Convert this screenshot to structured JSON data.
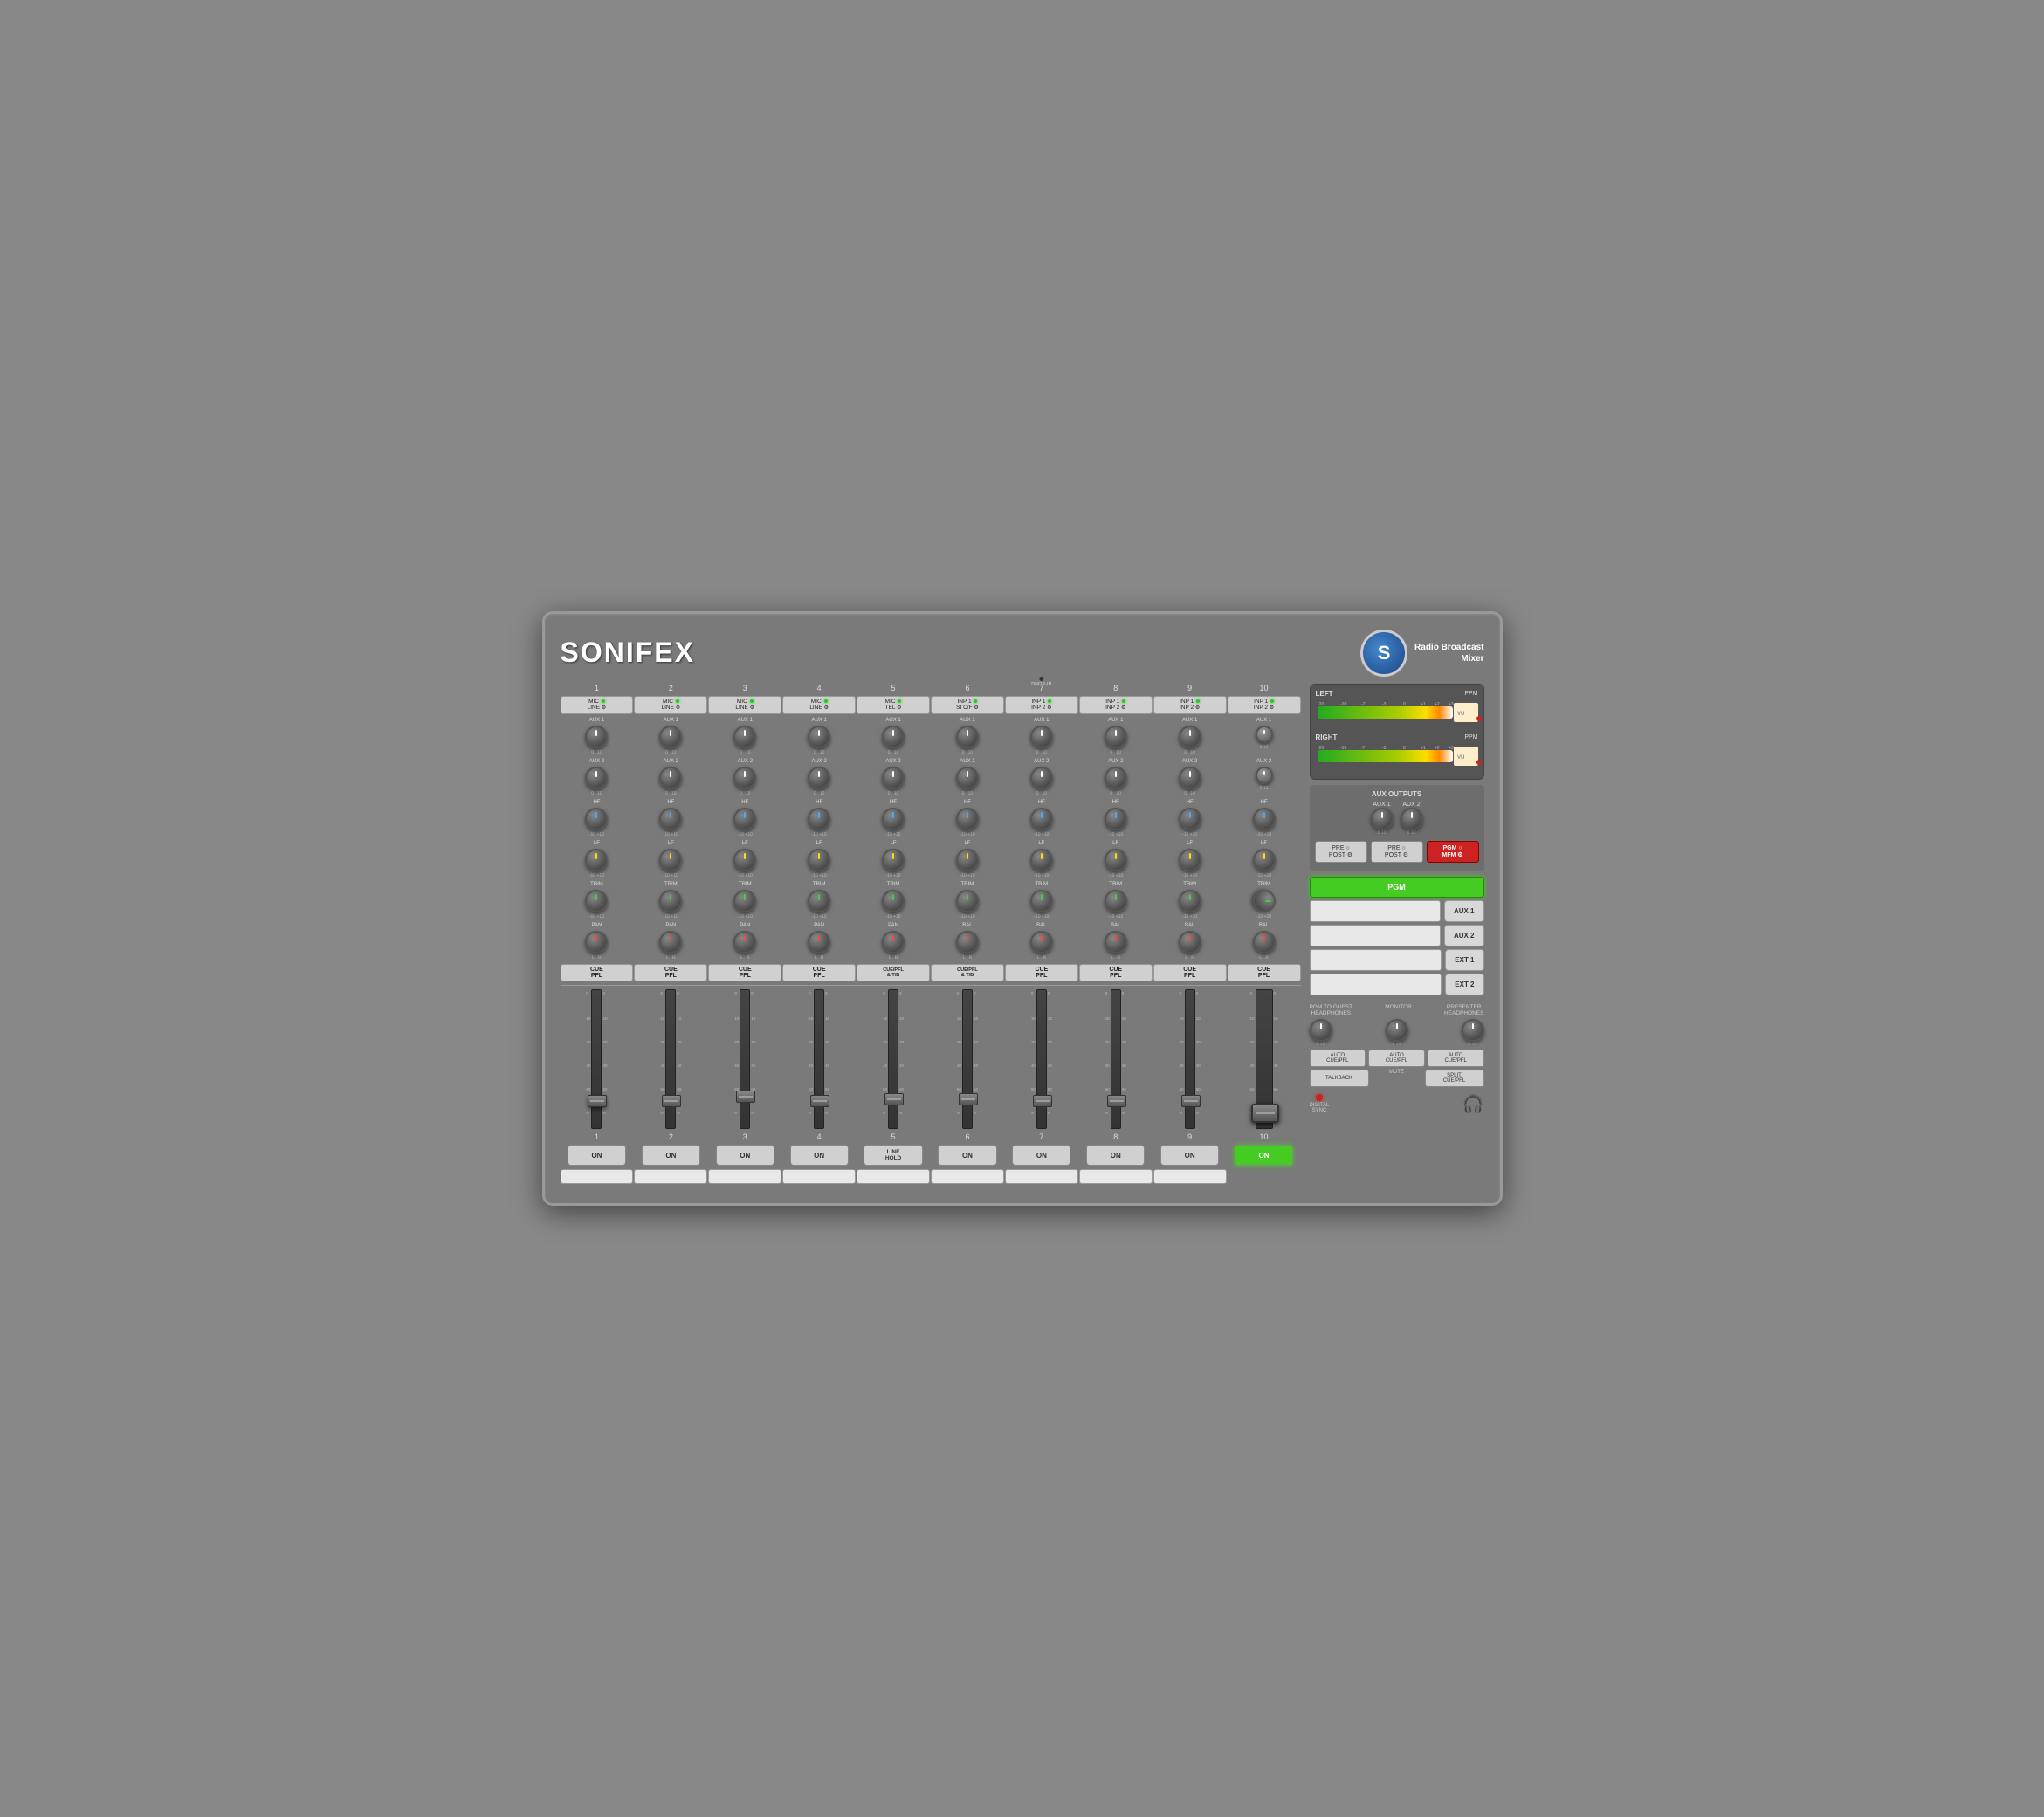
{
  "brand": "SONIFEX",
  "product_name": "Radio Broadcast\nMixer",
  "channels": [
    {
      "number": "1",
      "input_type": "MIC\nLINE",
      "has_led": true,
      "led_color": "green",
      "on_active": false,
      "on_label": "ON"
    },
    {
      "number": "2",
      "input_type": "MIC\nLINE",
      "has_led": true,
      "led_color": "green",
      "on_active": false,
      "on_label": "ON"
    },
    {
      "number": "3",
      "input_type": "MIC\nLINE",
      "has_led": true,
      "led_color": "green",
      "on_active": false,
      "on_label": "ON"
    },
    {
      "number": "4",
      "input_type": "MIC\nLINE",
      "has_led": true,
      "led_color": "green",
      "on_active": false,
      "on_label": "ON"
    },
    {
      "number": "5",
      "input_type": "MIC\nTEL",
      "has_led": true,
      "led_color": "green",
      "on_active": false,
      "on_label": "LINE\nHOLD"
    },
    {
      "number": "6",
      "input_type": "INP 1\nSt C/F",
      "has_led": true,
      "led_color": "green",
      "on_active": false,
      "on_label": "ON"
    },
    {
      "number": "7",
      "input_type": "INP 1\nINP 2",
      "has_led": true,
      "led_color": "green",
      "on_active": false,
      "on_label": "ON"
    },
    {
      "number": "8",
      "input_type": "INP 1\nINP 2",
      "has_led": true,
      "led_color": "green",
      "on_active": false,
      "on_label": "ON"
    },
    {
      "number": "9",
      "input_type": "INP 1\nINP 2",
      "has_led": true,
      "led_color": "green",
      "on_active": false,
      "on_label": "ON"
    },
    {
      "number": "10",
      "input_type": "INP 1\nINP 2",
      "has_led": true,
      "led_color": "green",
      "on_active": true,
      "on_label": "ON"
    }
  ],
  "knob_labels": {
    "aux1": "AUX 1",
    "aux2": "AUX 2",
    "hf": "HF",
    "lf": "LF",
    "trim": "TRIM",
    "pan_bal": "PAN",
    "bal": "BAL"
  },
  "cue_labels": [
    "CUE\nPFL",
    "CUE\nPFL",
    "CUE\nPFL",
    "CUE\nPFL",
    "CUE/PFL\n& T/B",
    "CUE/PFL\n& T/B",
    "CUE\nPFL",
    "CUE\nPFL",
    "CUE\nPFL",
    "CUE\nPFL"
  ],
  "fader_scales": [
    "0",
    "10",
    "20",
    "40",
    "60",
    "∞"
  ],
  "right_panel": {
    "vu_left_label": "LEFT",
    "vu_right_label": "RIGHT",
    "ppm_label": "PPM",
    "vu_label": "VU",
    "vu_scale": [
      "-20",
      "-10",
      "-7",
      "-3",
      "0",
      "+1",
      "+2",
      "+3"
    ],
    "aux_outputs_label": "AUX OUTPUTS",
    "aux1_label": "AUX 1",
    "aux2_label": "AUX 2",
    "pre_post_label": "PRE\nPOST",
    "pre_post2_label": "PRE\nPOST",
    "pgm_mfm_label": "PGM\nMFM",
    "pgm_btn_label": "PGM",
    "aux1_btn_label": "AUX 1",
    "aux2_btn_label": "AUX 2",
    "ext1_btn_label": "EXT 1",
    "ext2_btn_label": "EXT 2",
    "pgm_guest_label": "PGM TO GUEST\nHEADPHONES",
    "monitor_label": "MONITOR",
    "presenter_label": "PRESENTER\nHEADPHONES",
    "auto_cue_pfl_label": "AUTO\nCUE/PFL",
    "talkback_label": "TALKBACK",
    "mute_label": "MUTE",
    "split_cue_label": "SPLIT\nCUE/PFL",
    "digital_sync_label": "DIGITAL\nSYNC"
  }
}
